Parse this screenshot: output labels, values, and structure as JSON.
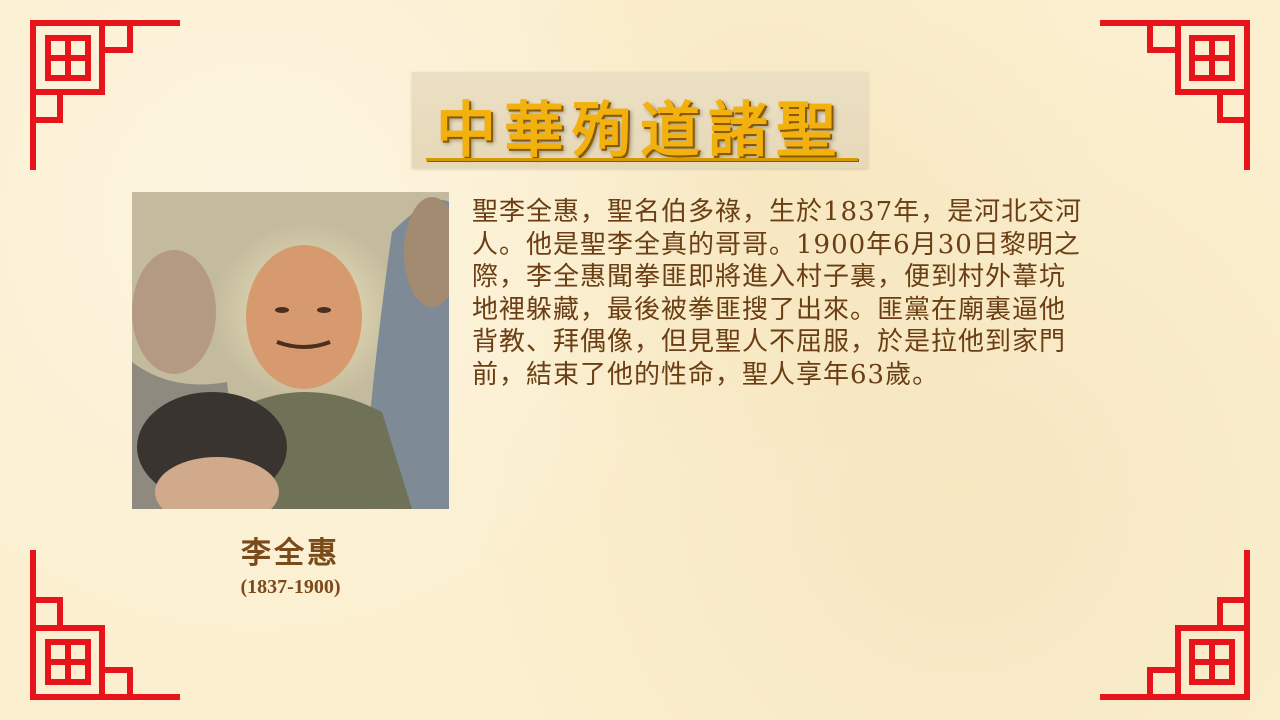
{
  "slide": {
    "title": "中華殉道諸聖",
    "portrait": {
      "name": "李全惠",
      "years": "(1837-1900)"
    },
    "bio_lines": [
      "聖李全惠，聖名伯多祿，生於1837年，是河北交河",
      "人。他是聖李全真的哥哥。1900年6月30日黎明之",
      "際，李全惠聞拳匪即將進入村子裏，便到村外葦坑",
      "地裡躲藏，最後被拳匪搜了出來。匪黨在廟裏逼他",
      "背教、拜偶像，但見聖人不屈服，於是拉他到家門",
      "前，結束了他的性命，聖人享年63歲。"
    ]
  },
  "colors": {
    "background": "#fbefcf",
    "corner_red": "#e8141b",
    "title_gold": "#f2b10f",
    "text_brown": "#6b3e14"
  },
  "icons": {
    "corner_ornament": "chinese-fret-corner-icon"
  }
}
